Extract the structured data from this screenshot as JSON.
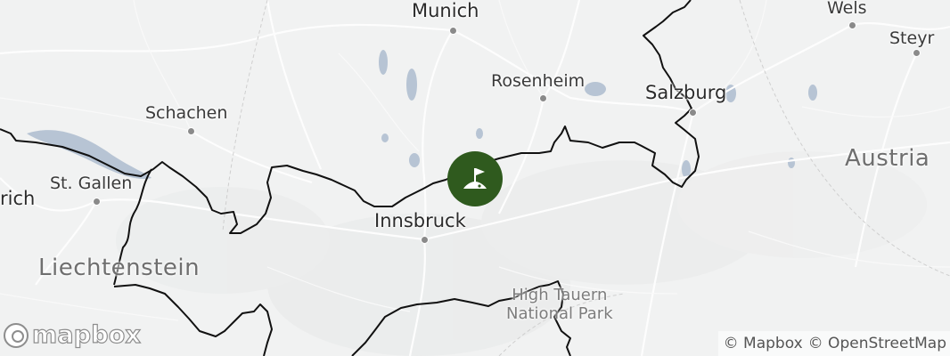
{
  "map": {
    "labels": {
      "munich": "Munich",
      "wels": "Wels",
      "steyr": "Steyr",
      "rosenheim": "Rosenheim",
      "salzburg": "Salzburg",
      "schachen": "Schachen",
      "austria": "Austria",
      "st_gallen": "St. Gallen",
      "zurich_partial": "rich",
      "innsbruck": "Innsbruck",
      "liechtenstein": "Liechtenstein",
      "park": "High Tauern\nNational Park"
    },
    "marker": {
      "icon": "golf-flag-icon",
      "color": "#2f5a1e"
    }
  },
  "logo": {
    "text": "mapbox"
  },
  "attribution": {
    "mapbox": "© Mapbox",
    "osm": "© OpenStreetMap"
  },
  "colors": {
    "border": "#111111",
    "water": "#b7c4d4",
    "road": "#ffffff",
    "land": "#f1f2f2"
  }
}
